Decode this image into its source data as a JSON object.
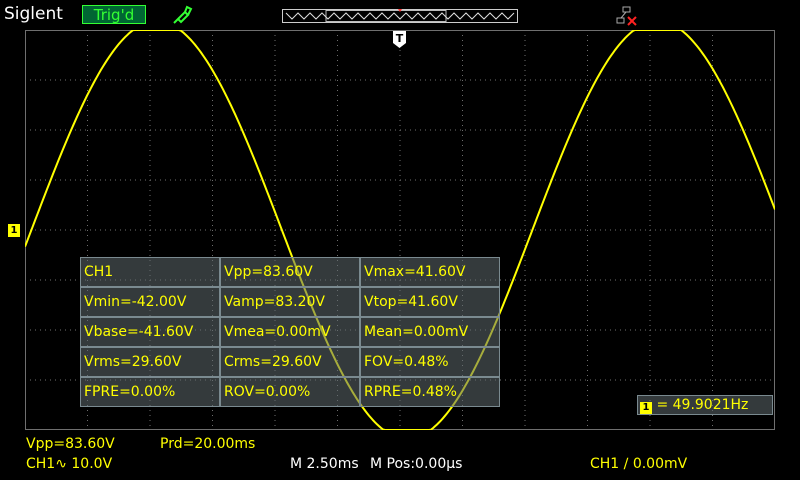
{
  "header": {
    "brand": "Siglent",
    "trigger_status": "Trig'd"
  },
  "markers": {
    "channel_marker": "1",
    "trigger_marker": "T",
    "freq_marker": "1"
  },
  "measurements": {
    "rows": [
      [
        "CH1",
        "Vpp=83.60V",
        "Vmax=41.60V"
      ],
      [
        "Vmin=-42.00V",
        "Vamp=83.20V",
        "Vtop=41.60V"
      ],
      [
        "Vbase=-41.60V",
        "Vmea=0.00mV",
        "Mean=0.00mV"
      ],
      [
        "Vrms=29.60V",
        "Crms=29.60V",
        "FOV=0.48%"
      ],
      [
        "FPRE=0.00%",
        "ROV=0.00%",
        "RPRE=0.48%"
      ]
    ]
  },
  "frequency": "= 49.9021Hz",
  "footer": {
    "vpp": "Vpp=83.60V",
    "period": "Prd=20.00ms",
    "ch1_scale": "CH1∿ 10.0V",
    "timebase": "M 2.50ms",
    "mpos": "M Pos:0.00μs",
    "trigger_level": "CH1 ∕ 0.00mV"
  },
  "colors": {
    "trace": "#ffff00",
    "grid": "#6f6f6f",
    "trig_status": "#33ff33"
  },
  "waveform": {
    "frequency_hz": 49.9021,
    "amplitude_v": 41.8,
    "volts_per_div": 10.0,
    "time_per_div_ms": 2.5
  }
}
